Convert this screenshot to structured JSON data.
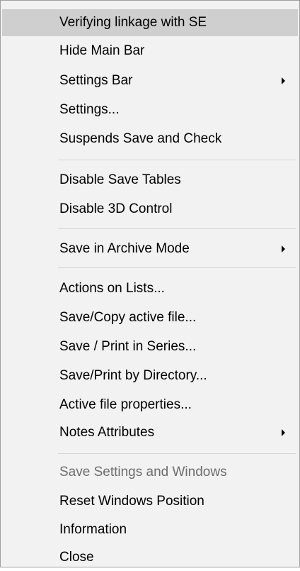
{
  "menu": {
    "items": [
      {
        "label": "Verifying linkage with SE"
      },
      {
        "label": "Hide Main Bar"
      },
      {
        "label": "Settings Bar"
      },
      {
        "label": "Settings..."
      },
      {
        "label": "Suspends Save and Check"
      },
      {
        "label": "Disable Save Tables"
      },
      {
        "label": "Disable 3D Control"
      },
      {
        "label": "Save in Archive Mode"
      },
      {
        "label": "Actions on Lists..."
      },
      {
        "label": "Save/Copy active file..."
      },
      {
        "label": "Save / Print in Series..."
      },
      {
        "label": "Save/Print by Directory..."
      },
      {
        "label": "Active file properties..."
      },
      {
        "label": "Notes Attributes"
      },
      {
        "label": "Save Settings and Windows",
        "state": "disabled"
      },
      {
        "label": "Reset Windows Position"
      },
      {
        "label": "Information"
      },
      {
        "label": "Close"
      }
    ]
  }
}
